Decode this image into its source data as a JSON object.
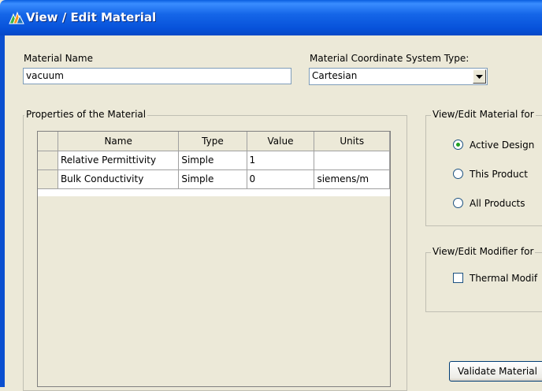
{
  "window": {
    "title": "View / Edit Material",
    "icon": "material-app-icon"
  },
  "material_name": {
    "label": "Material Name",
    "value": "vacuum"
  },
  "coordinate_system": {
    "label": "Material Coordinate System Type:",
    "selected": "Cartesian"
  },
  "properties_group": {
    "label": "Properties of the Material",
    "columns": [
      "Name",
      "Type",
      "Value",
      "Units"
    ],
    "rows": [
      {
        "name": "Relative Permittivity",
        "type": "Simple",
        "value": "1",
        "units": ""
      },
      {
        "name": "Bulk Conductivity",
        "type": "Simple",
        "value": "0",
        "units": "siemens/m"
      }
    ]
  },
  "view_edit_material_for": {
    "label": "View/Edit Material for",
    "options": [
      "Active Design",
      "This Product",
      "All Products"
    ],
    "selected": "Active Design"
  },
  "view_edit_modifier_for": {
    "label": "View/Edit Modifier for",
    "checkbox_label": "Thermal Modif",
    "checked": false
  },
  "validate_button": {
    "label": "Validate Material"
  },
  "colors": {
    "titlebar": "#0752DA",
    "dialog_bg": "#ECE9D8",
    "radio_dot": "#21A121"
  }
}
